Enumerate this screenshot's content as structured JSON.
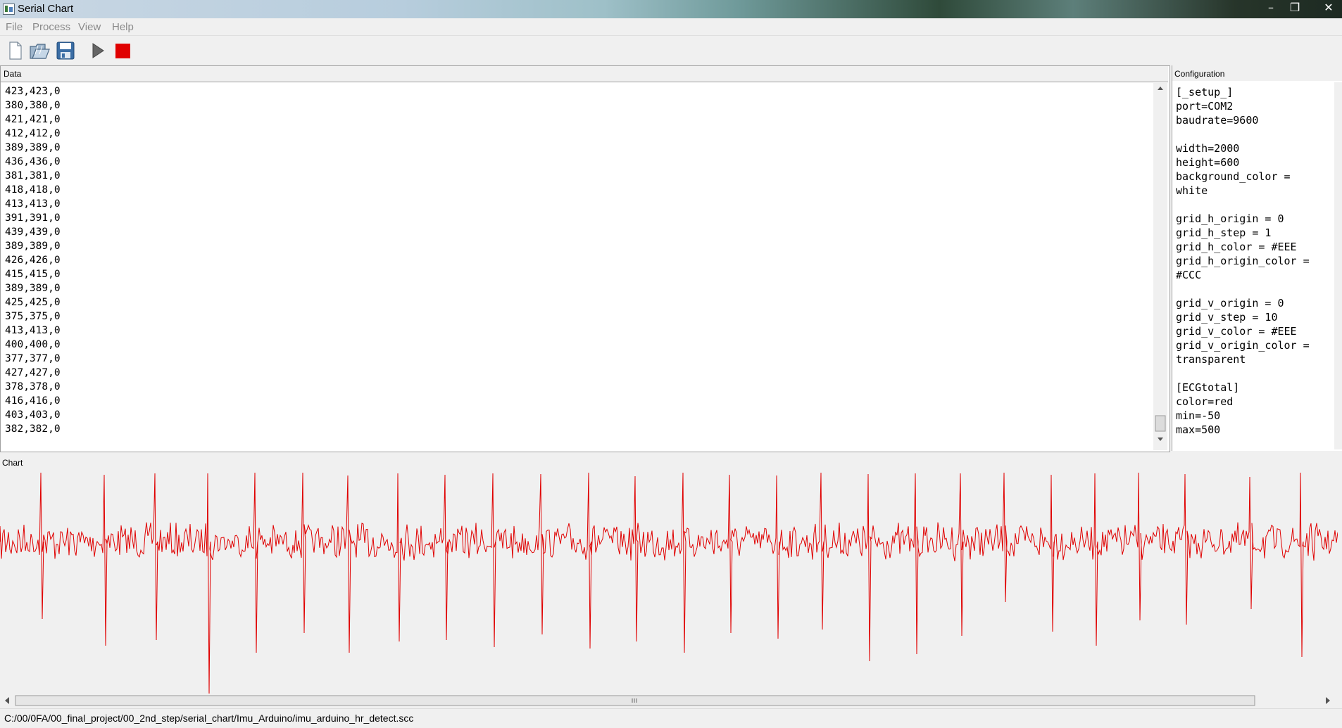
{
  "window": {
    "title": "Serial Chart",
    "controls": [
      "–",
      "❐",
      "✕"
    ]
  },
  "menu": [
    "File",
    "Process",
    "View",
    "Help"
  ],
  "toolbar": {
    "icons": [
      "new-file-icon",
      "open-folder-icon",
      "save-icon",
      "play-icon",
      "stop-icon"
    ],
    "stop_color": "#e00000"
  },
  "data_panel": {
    "title": "Data",
    "lines": [
      "423,423,0",
      "380,380,0",
      "421,421,0",
      "412,412,0",
      "389,389,0",
      "436,436,0",
      "381,381,0",
      "418,418,0",
      "413,413,0",
      "391,391,0",
      "439,439,0",
      "389,389,0",
      "426,426,0",
      "415,415,0",
      "389,389,0",
      "425,425,0",
      "375,375,0",
      "413,413,0",
      "400,400,0",
      "377,377,0",
      "427,427,0",
      "378,378,0",
      "416,416,0",
      "403,403,0",
      "382,382,0"
    ]
  },
  "config_panel": {
    "title": "Configuration",
    "lines": [
      "[_setup_]",
      "port=COM2",
      "baudrate=9600",
      "",
      "width=2000",
      "height=600",
      "background_color =",
      "white",
      "",
      "grid_h_origin = 0",
      "grid_h_step = 1",
      "grid_h_color = #EEE",
      "grid_h_origin_color =",
      "#CCC",
      "",
      "grid_v_origin = 0",
      "grid_v_step = 10",
      "grid_v_color = #EEE",
      "grid_v_origin_color =",
      "transparent",
      "",
      "[ECGtotal]",
      "color=red",
      "min=-50",
      "max=500"
    ]
  },
  "chart_panel": {
    "title": "Chart",
    "line_color": "#e00000"
  },
  "status_bar": {
    "path": "C:/00/0FA/00_final_project/00_2nd_step/serial_chart/Imu_Arduino/imu_arduino_hr_detect.scc"
  }
}
